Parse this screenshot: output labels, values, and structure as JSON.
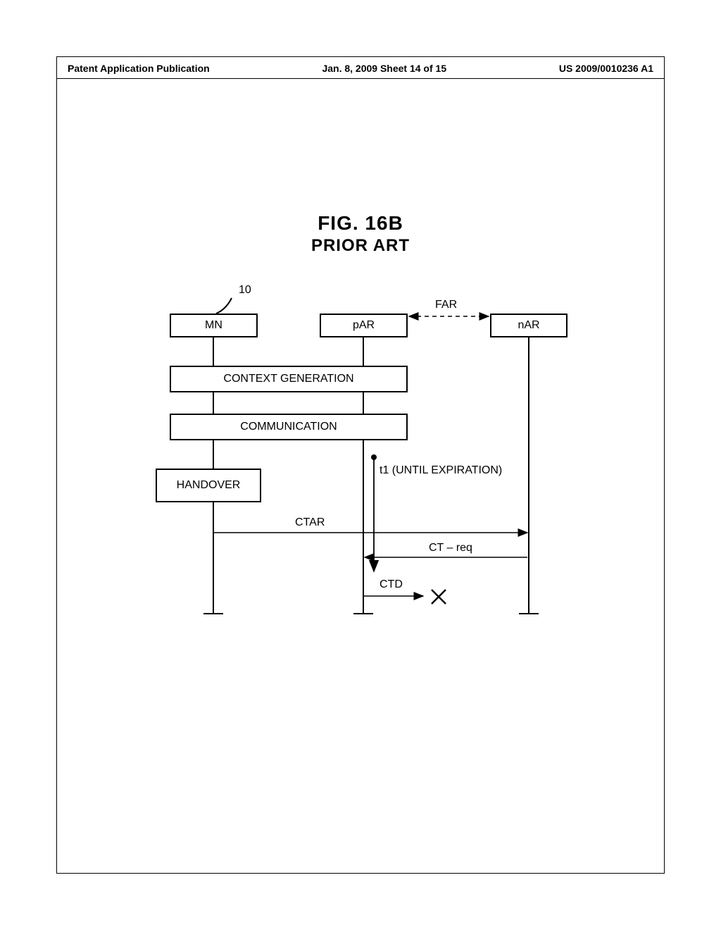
{
  "header": {
    "left": "Patent Application Publication",
    "center": "Jan. 8, 2009  Sheet 14 of 15",
    "right": "US 2009/0010236 A1"
  },
  "figure": {
    "title": "FIG. 16B",
    "subtitle": "PRIOR ART"
  },
  "ref": {
    "num10": "10"
  },
  "boxes": {
    "mn": "MN",
    "par": "pAR",
    "nar": "nAR",
    "context": "CONTEXT GENERATION",
    "communication": "COMMUNICATION",
    "handover": "HANDOVER"
  },
  "labels": {
    "far": "FAR",
    "t1": "t1 (UNTIL EXPIRATION)",
    "ctar": "CTAR",
    "ctreq": "CT – req",
    "ctd": "CTD"
  }
}
